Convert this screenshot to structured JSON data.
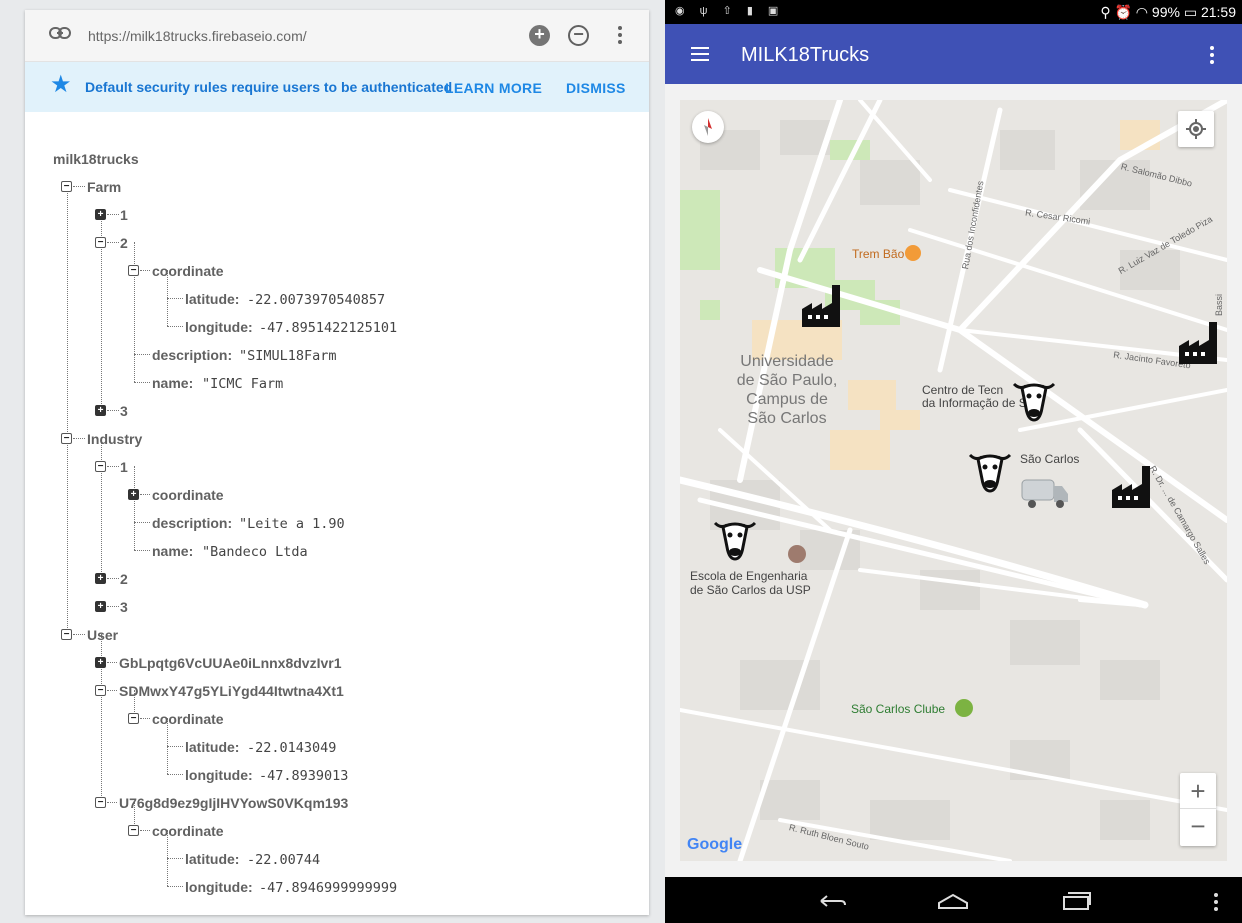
{
  "firebase": {
    "url": "https://milk18trucks.firebaseio.com/",
    "banner": {
      "message": "Default security rules require users to be authenticated",
      "learn_more": "LEARN MORE",
      "dismiss": "DISMISS"
    },
    "tree": {
      "root": "milk18trucks",
      "farm": {
        "label": "Farm",
        "n1": "1",
        "n2": "2",
        "coordinate": "coordinate",
        "latitude_key": "latitude:",
        "latitude_value": "-22.0073970540857",
        "longitude_key": "longitude:",
        "longitude_value": "-47.8951422125101",
        "description_key": "description:",
        "description_value": "\"SIMUL18Farm",
        "name_key": "name:",
        "name_value": "\"ICMC Farm",
        "n3": "3"
      },
      "industry": {
        "label": "Industry",
        "n1": "1",
        "coordinate": "coordinate",
        "description_key": "description:",
        "description_value": "\"Leite a 1.90",
        "name_key": "name:",
        "name_value": "\"Bandeco Ltda",
        "n2": "2",
        "n3": "3"
      },
      "user": {
        "label": "User",
        "u1": "GbLpqtg6VcUUAe0iLnnx8dvzIvr1",
        "u2": "SDMwxY47g5YLiYgd44Itwtna4Xt1",
        "u2_coordinate": "coordinate",
        "u2_latitude_key": "latitude:",
        "u2_latitude_value": "-22.0143049",
        "u2_longitude_key": "longitude:",
        "u2_longitude_value": "-47.8939013",
        "u3": "U76g8d9ez9gIjIHVYowS0VKqm193",
        "u3_coordinate": "coordinate",
        "u3_latitude_key": "latitude:",
        "u3_latitude_value": "-22.00744",
        "u3_longitude_key": "longitude:",
        "u3_longitude_value": "-47.8946999999999"
      }
    }
  },
  "tablet": {
    "status": {
      "battery": "99%",
      "time": "21:59"
    },
    "appbar": {
      "title": "MILK18Trucks"
    },
    "map": {
      "labels": {
        "trem_bao": "Trem Bão",
        "universidade": "Universidade\nde São Paulo,\nCampus de\nSão Carlos",
        "centro": "Centro de Tecn\nda Informação de S",
        "sao_carlos": "São Carlos",
        "escola": "Escola de Engenharia\nde São Carlos da USP",
        "clube": "São Carlos Clube"
      },
      "streets": {
        "salomao": "R. Salomão Dibbo",
        "cesar": "R. Cesar Ricomi",
        "luiz": "R. Luiz Vaz de Toledo Piza",
        "incon": "Rua dos Inconfidentes",
        "jacinto": "R. Jacinto Favoreto",
        "camargo": "R. Dr. ... de Camargo Salles",
        "ruth": "R. Ruth Bloen Souto",
        "bassi": "Bassi"
      },
      "zoom_in": "+",
      "zoom_out": "−",
      "attribution": "Google"
    }
  }
}
